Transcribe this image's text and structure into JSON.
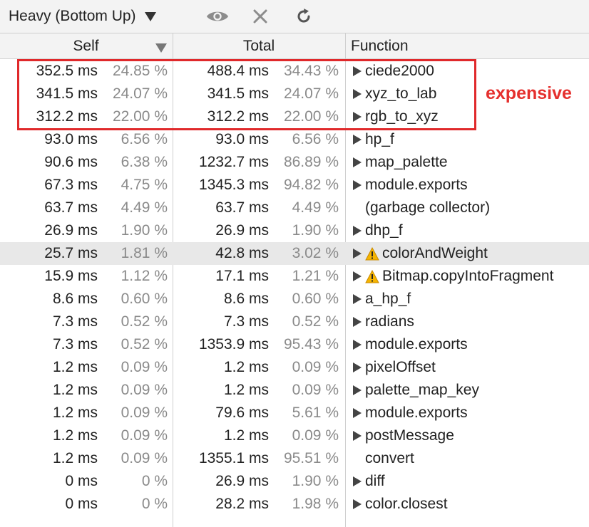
{
  "toolbar": {
    "view_mode": "Heavy (Bottom Up)",
    "focus_icon": "eye-icon",
    "exclude_icon": "close-icon",
    "restore_icon": "refresh-icon"
  },
  "columns": {
    "self": "Self",
    "total": "Total",
    "function": "Function"
  },
  "annotation": "expensive",
  "colors": {
    "highlight": "#e0292b",
    "annotation": "#e5302e",
    "warning": "#f5b400"
  },
  "rows": [
    {
      "self_ms": "352.5 ms",
      "self_pct": "24.85 %",
      "total_ms": "488.4 ms",
      "total_pct": "34.43 %",
      "function": "ciede2000",
      "expandable": true,
      "warning": false
    },
    {
      "self_ms": "341.5 ms",
      "self_pct": "24.07 %",
      "total_ms": "341.5 ms",
      "total_pct": "24.07 %",
      "function": "xyz_to_lab",
      "expandable": true,
      "warning": false
    },
    {
      "self_ms": "312.2 ms",
      "self_pct": "22.00 %",
      "total_ms": "312.2 ms",
      "total_pct": "22.00 %",
      "function": "rgb_to_xyz",
      "expandable": true,
      "warning": false
    },
    {
      "self_ms": "93.0 ms",
      "self_pct": "6.56 %",
      "total_ms": "93.0 ms",
      "total_pct": "6.56 %",
      "function": "hp_f",
      "expandable": true,
      "warning": false
    },
    {
      "self_ms": "90.6 ms",
      "self_pct": "6.38 %",
      "total_ms": "1232.7 ms",
      "total_pct": "86.89 %",
      "function": "map_palette",
      "expandable": true,
      "warning": false
    },
    {
      "self_ms": "67.3 ms",
      "self_pct": "4.75 %",
      "total_ms": "1345.3 ms",
      "total_pct": "94.82 %",
      "function": "module.exports",
      "expandable": true,
      "warning": false
    },
    {
      "self_ms": "63.7 ms",
      "self_pct": "4.49 %",
      "total_ms": "63.7 ms",
      "total_pct": "4.49 %",
      "function": "(garbage collector)",
      "expandable": false,
      "warning": false
    },
    {
      "self_ms": "26.9 ms",
      "self_pct": "1.90 %",
      "total_ms": "26.9 ms",
      "total_pct": "1.90 %",
      "function": "dhp_f",
      "expandable": true,
      "warning": false
    },
    {
      "self_ms": "25.7 ms",
      "self_pct": "1.81 %",
      "total_ms": "42.8 ms",
      "total_pct": "3.02 %",
      "function": "colorAndWeight",
      "expandable": true,
      "warning": true,
      "selected": true
    },
    {
      "self_ms": "15.9 ms",
      "self_pct": "1.12 %",
      "total_ms": "17.1 ms",
      "total_pct": "1.21 %",
      "function": "Bitmap.copyIntoFragment",
      "expandable": true,
      "warning": true
    },
    {
      "self_ms": "8.6 ms",
      "self_pct": "0.60 %",
      "total_ms": "8.6 ms",
      "total_pct": "0.60 %",
      "function": "a_hp_f",
      "expandable": true,
      "warning": false
    },
    {
      "self_ms": "7.3 ms",
      "self_pct": "0.52 %",
      "total_ms": "7.3 ms",
      "total_pct": "0.52 %",
      "function": "radians",
      "expandable": true,
      "warning": false
    },
    {
      "self_ms": "7.3 ms",
      "self_pct": "0.52 %",
      "total_ms": "1353.9 ms",
      "total_pct": "95.43 %",
      "function": "module.exports",
      "expandable": true,
      "warning": false
    },
    {
      "self_ms": "1.2 ms",
      "self_pct": "0.09 %",
      "total_ms": "1.2 ms",
      "total_pct": "0.09 %",
      "function": "pixelOffset",
      "expandable": true,
      "warning": false
    },
    {
      "self_ms": "1.2 ms",
      "self_pct": "0.09 %",
      "total_ms": "1.2 ms",
      "total_pct": "0.09 %",
      "function": "palette_map_key",
      "expandable": true,
      "warning": false
    },
    {
      "self_ms": "1.2 ms",
      "self_pct": "0.09 %",
      "total_ms": "79.6 ms",
      "total_pct": "5.61 %",
      "function": "module.exports",
      "expandable": true,
      "warning": false
    },
    {
      "self_ms": "1.2 ms",
      "self_pct": "0.09 %",
      "total_ms": "1.2 ms",
      "total_pct": "0.09 %",
      "function": "postMessage",
      "expandable": true,
      "warning": false
    },
    {
      "self_ms": "1.2 ms",
      "self_pct": "0.09 %",
      "total_ms": "1355.1 ms",
      "total_pct": "95.51 %",
      "function": "convert",
      "expandable": false,
      "warning": false
    },
    {
      "self_ms": "0 ms",
      "self_pct": "0 %",
      "total_ms": "26.9 ms",
      "total_pct": "1.90 %",
      "function": "diff",
      "expandable": true,
      "warning": false
    },
    {
      "self_ms": "0 ms",
      "self_pct": "0 %",
      "total_ms": "28.2 ms",
      "total_pct": "1.98 %",
      "function": "color.closest",
      "expandable": true,
      "warning": false
    }
  ]
}
